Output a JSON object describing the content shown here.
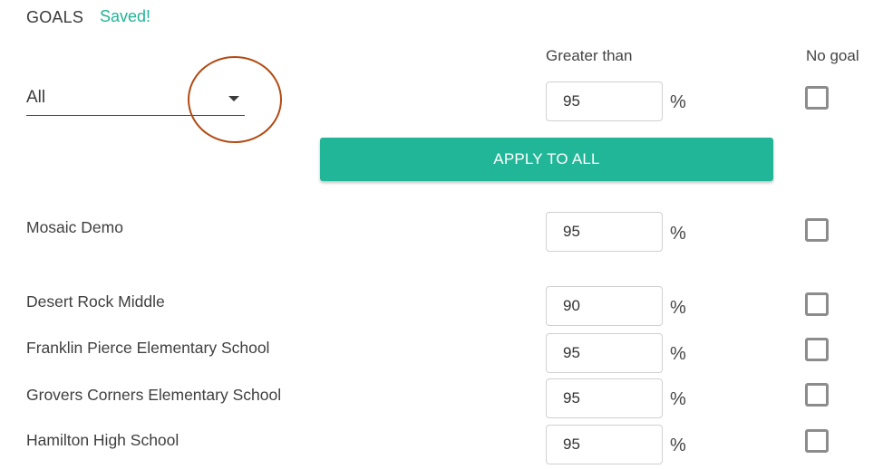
{
  "header": {
    "title": "GOALS",
    "status": "Saved!"
  },
  "columns": {
    "threshold": "Greater than",
    "no_goal": "No goal"
  },
  "filter": {
    "selected": "All",
    "icon": "caret-down-icon"
  },
  "bulk": {
    "value": "95",
    "unit": "%",
    "no_goal": false,
    "apply_label": "APPLY TO ALL"
  },
  "rows": [
    {
      "name": "Mosaic Demo",
      "value": "95",
      "unit": "%",
      "no_goal": false
    },
    {
      "name": "Desert Rock Middle",
      "value": "90",
      "unit": "%",
      "no_goal": false
    },
    {
      "name": "Franklin Pierce Elementary School",
      "value": "95",
      "unit": "%",
      "no_goal": false
    },
    {
      "name": "Grovers Corners Elementary School",
      "value": "95",
      "unit": "%",
      "no_goal": false
    },
    {
      "name": "Hamilton High School",
      "value": "95",
      "unit": "%",
      "no_goal": false
    }
  ],
  "colors": {
    "accent": "#22b698",
    "saved": "#22b496",
    "annotation": "#b24a13"
  }
}
